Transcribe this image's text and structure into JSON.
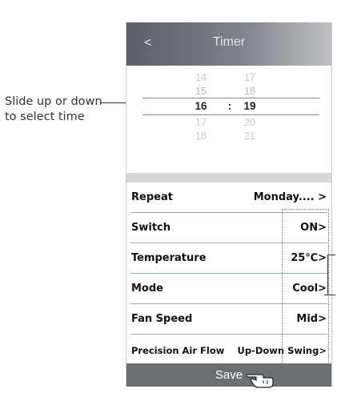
{
  "annotation": {
    "line1": "Slide up or down",
    "line2": "to select time"
  },
  "header": {
    "back": "<",
    "title": "Timer"
  },
  "picker": {
    "rows": [
      {
        "hour": "14",
        "minute": "17"
      },
      {
        "hour": "15",
        "minute": "18"
      },
      {
        "hour": "16",
        "minute": "19"
      },
      {
        "hour": "17",
        "minute": "20"
      },
      {
        "hour": "18",
        "minute": "21"
      }
    ],
    "separator": ":"
  },
  "settings": [
    {
      "label": "Repeat",
      "value": "Monday.... >"
    },
    {
      "label": "Switch",
      "value": "ON>"
    },
    {
      "label": "Temperature",
      "value": "25℃>"
    },
    {
      "label": "Mode",
      "value": "Cool>"
    },
    {
      "label": "Fan Speed",
      "value": "Mid>"
    },
    {
      "label": "Precision Air Flow",
      "value": "Up-Down Swing>"
    }
  ],
  "footer": {
    "save": "Save"
  },
  "icons": {
    "pointer": "pointing-hand-icon"
  }
}
